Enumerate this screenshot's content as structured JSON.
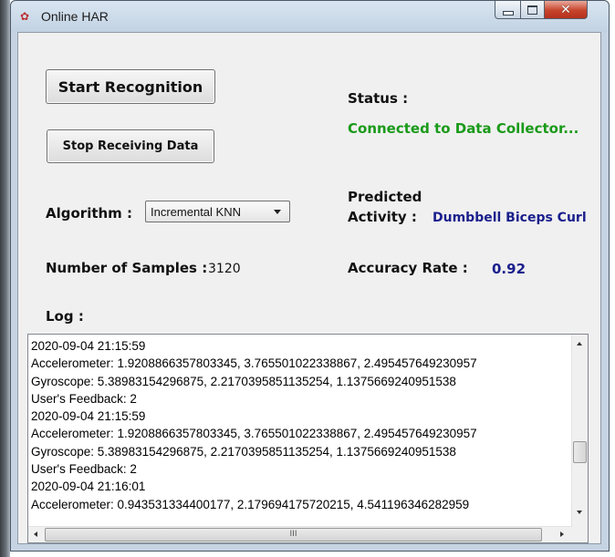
{
  "window": {
    "title": "Online HAR"
  },
  "buttons": {
    "start_recognition": "Start Recognition",
    "stop_receiving": "Stop Receiving Data"
  },
  "status": {
    "label": "Status :",
    "value": "Connected to Data Collector...",
    "color": "#1a9a1a"
  },
  "algorithm": {
    "label": "Algorithm :",
    "selected": "Incremental KNN"
  },
  "prediction": {
    "label_line1": "Predicted",
    "label_line2": "Activity :",
    "value": "Dumbbell Biceps Curl",
    "color": "#1a1f8c"
  },
  "samples": {
    "label": "Number of Samples :",
    "value": "3120"
  },
  "accuracy": {
    "label": "Accuracy Rate :",
    "value": "0.92"
  },
  "log": {
    "label": "Log :",
    "lines": [
      "2020-09-04 21:15:59",
      "Accelerometer: 1.9208866357803345, 3.765501022338867, 2.495457649230957",
      "Gyroscope: 5.38983154296875, 2.2170395851135254, 1.1375669240951538",
      "User's Feedback: 2",
      "2020-09-04 21:15:59",
      "Accelerometer: 1.9208866357803345, 3.765501022338867, 2.495457649230957",
      "Gyroscope: 5.38983154296875, 2.2170395851135254, 1.1375669240951538",
      "User's Feedback: 2",
      "2020-09-04 21:16:01",
      "Accelerometer: 0.943531334400177, 2.179694175720215, 4.541196346282959"
    ],
    "scroll_thumb_grip": "III"
  }
}
